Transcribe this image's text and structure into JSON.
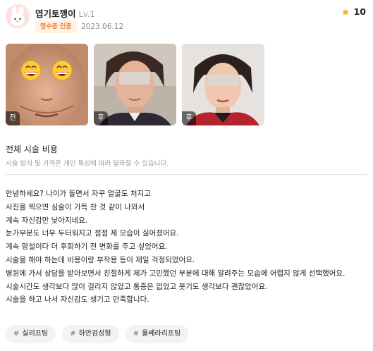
{
  "review": {
    "nickname": "엽기토깽이",
    "level": "Lv.1",
    "badge": "영수증 인증",
    "date": "2023.06.12",
    "rating": "10"
  },
  "photos": [
    {
      "tag": "전"
    },
    {
      "tag": "후"
    },
    {
      "tag": "후"
    }
  ],
  "cost": {
    "title": "전체 시술 비용",
    "note": "시술 방식 및 가격은 개인 특성에 따라 달라질 수 있습니다."
  },
  "body": [
    "안녕하세요? 나이가 들면서 자꾸 얼굴도 처지고",
    "사진을 찍으면 심술이 가득 찬 것 같이 나와서",
    "계속 자신감만 낮아지네요.",
    "눈가부분도 너무 두터워지고 점점 제 모습이 싫어졌어요.",
    "계속 망설이다 더 후회하기 전 변화를 주고 싶었어요.",
    "시술을 해야 하는데 비용이랑 부작용 등이 제일 걱정되었어요.",
    "병원에 가서 상담을 받아보면서 친절하게 제가 고민했던 부분에 대해 알려주는 모습에 어렵지 않게 선택했어요.",
    "시술시간도 생각보다 많이 걸리지 않았고 통증은 없었고 붓기도 생각보다 괜찮았어요.",
    "시술을 하고 나서 자신감도 생기고 만족합니다."
  ],
  "tags": [
    {
      "hash": "#",
      "label": "실리프팅"
    },
    {
      "hash": "#",
      "label": "하안검성형"
    },
    {
      "hash": "#",
      "label": "울쎄라리프팅"
    }
  ],
  "icons": {
    "star": "star-icon",
    "avatar": "rabbit-avatar-icon",
    "emoji": "grinning-face-emoji-icon"
  },
  "colors": {
    "badge_bg": "#fff1e4",
    "badge_text": "#ef7e33",
    "star": "#f6b51f",
    "avatar_bg": "#fde1e1"
  }
}
